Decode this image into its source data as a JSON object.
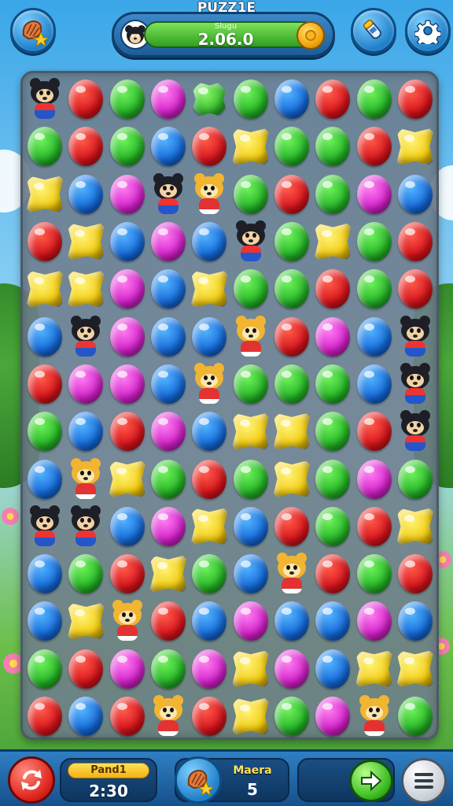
{
  "header": {
    "title": "PUZZ1E",
    "score_sublabel": "Slugu",
    "score_value": "2.06.0"
  },
  "board": {
    "rows": [
      [
        "black-bear",
        "red",
        "green",
        "magenta",
        "leaf",
        "green",
        "blue",
        "red",
        "green",
        "red"
      ],
      [
        "green",
        "red",
        "green",
        "blue",
        "red",
        "yellow",
        "green",
        "green",
        "red",
        "yellow"
      ],
      [
        "yellow",
        "blue",
        "magenta",
        "black-bear",
        "honey-bear",
        "green",
        "red",
        "green",
        "magenta",
        "blue"
      ],
      [
        "red",
        "yellow",
        "blue",
        "magenta",
        "blue",
        "black-bear",
        "green",
        "yellow",
        "green",
        "red"
      ],
      [
        "yellow",
        "yellow",
        "magenta",
        "blue",
        "yellow",
        "green",
        "green",
        "red",
        "green",
        "red"
      ],
      [
        "blue",
        "black-bear",
        "magenta",
        "blue",
        "blue",
        "honey-bear",
        "red",
        "magenta",
        "blue",
        "black-bear"
      ],
      [
        "red",
        "magenta",
        "magenta",
        "blue",
        "honey-bear",
        "green",
        "green",
        "green",
        "blue",
        "black-bear"
      ],
      [
        "green",
        "blue",
        "red",
        "magenta",
        "blue",
        "yellow",
        "yellow",
        "green",
        "red",
        "black-bear"
      ],
      [
        "blue",
        "honey-bear",
        "yellow",
        "green",
        "red",
        "green",
        "yellow",
        "green",
        "magenta",
        "green"
      ],
      [
        "black-bear",
        "black-bear",
        "blue",
        "magenta",
        "yellow",
        "blue",
        "red",
        "green",
        "red",
        "yellow"
      ],
      [
        "blue",
        "green",
        "red",
        "yellow",
        "green",
        "blue",
        "honey-bear",
        "red",
        "green",
        "red"
      ],
      [
        "blue",
        "yellow",
        "honey-bear",
        "red",
        "blue",
        "magenta",
        "blue",
        "blue",
        "magenta",
        "blue"
      ],
      [
        "green",
        "red",
        "magenta",
        "green",
        "magenta",
        "yellow",
        "magenta",
        "blue",
        "yellow",
        "yellow"
      ],
      [
        "red",
        "blue",
        "red",
        "honey-bear",
        "red",
        "yellow",
        "green",
        "magenta",
        "honey-bear",
        "green"
      ]
    ]
  },
  "footer": {
    "timer_label": "Pand1",
    "timer_value": "2:30",
    "moves_label": "Maera",
    "moves_value": "5"
  },
  "icons": {
    "top_left": "shell-star-icon",
    "top_right_a": "rocket-icon",
    "top_right_b": "gear-icon",
    "bottom_left": "shuffle-icon",
    "bottom_mid": "shell-star-icon",
    "bottom_next": "arrow-right-icon",
    "bottom_menu": "menu-icon"
  },
  "colors": {
    "red": "#d5121a",
    "green": "#23b325",
    "blue": "#1368d8",
    "magenta": "#d21fc8",
    "yellow": "#f2cc12"
  }
}
